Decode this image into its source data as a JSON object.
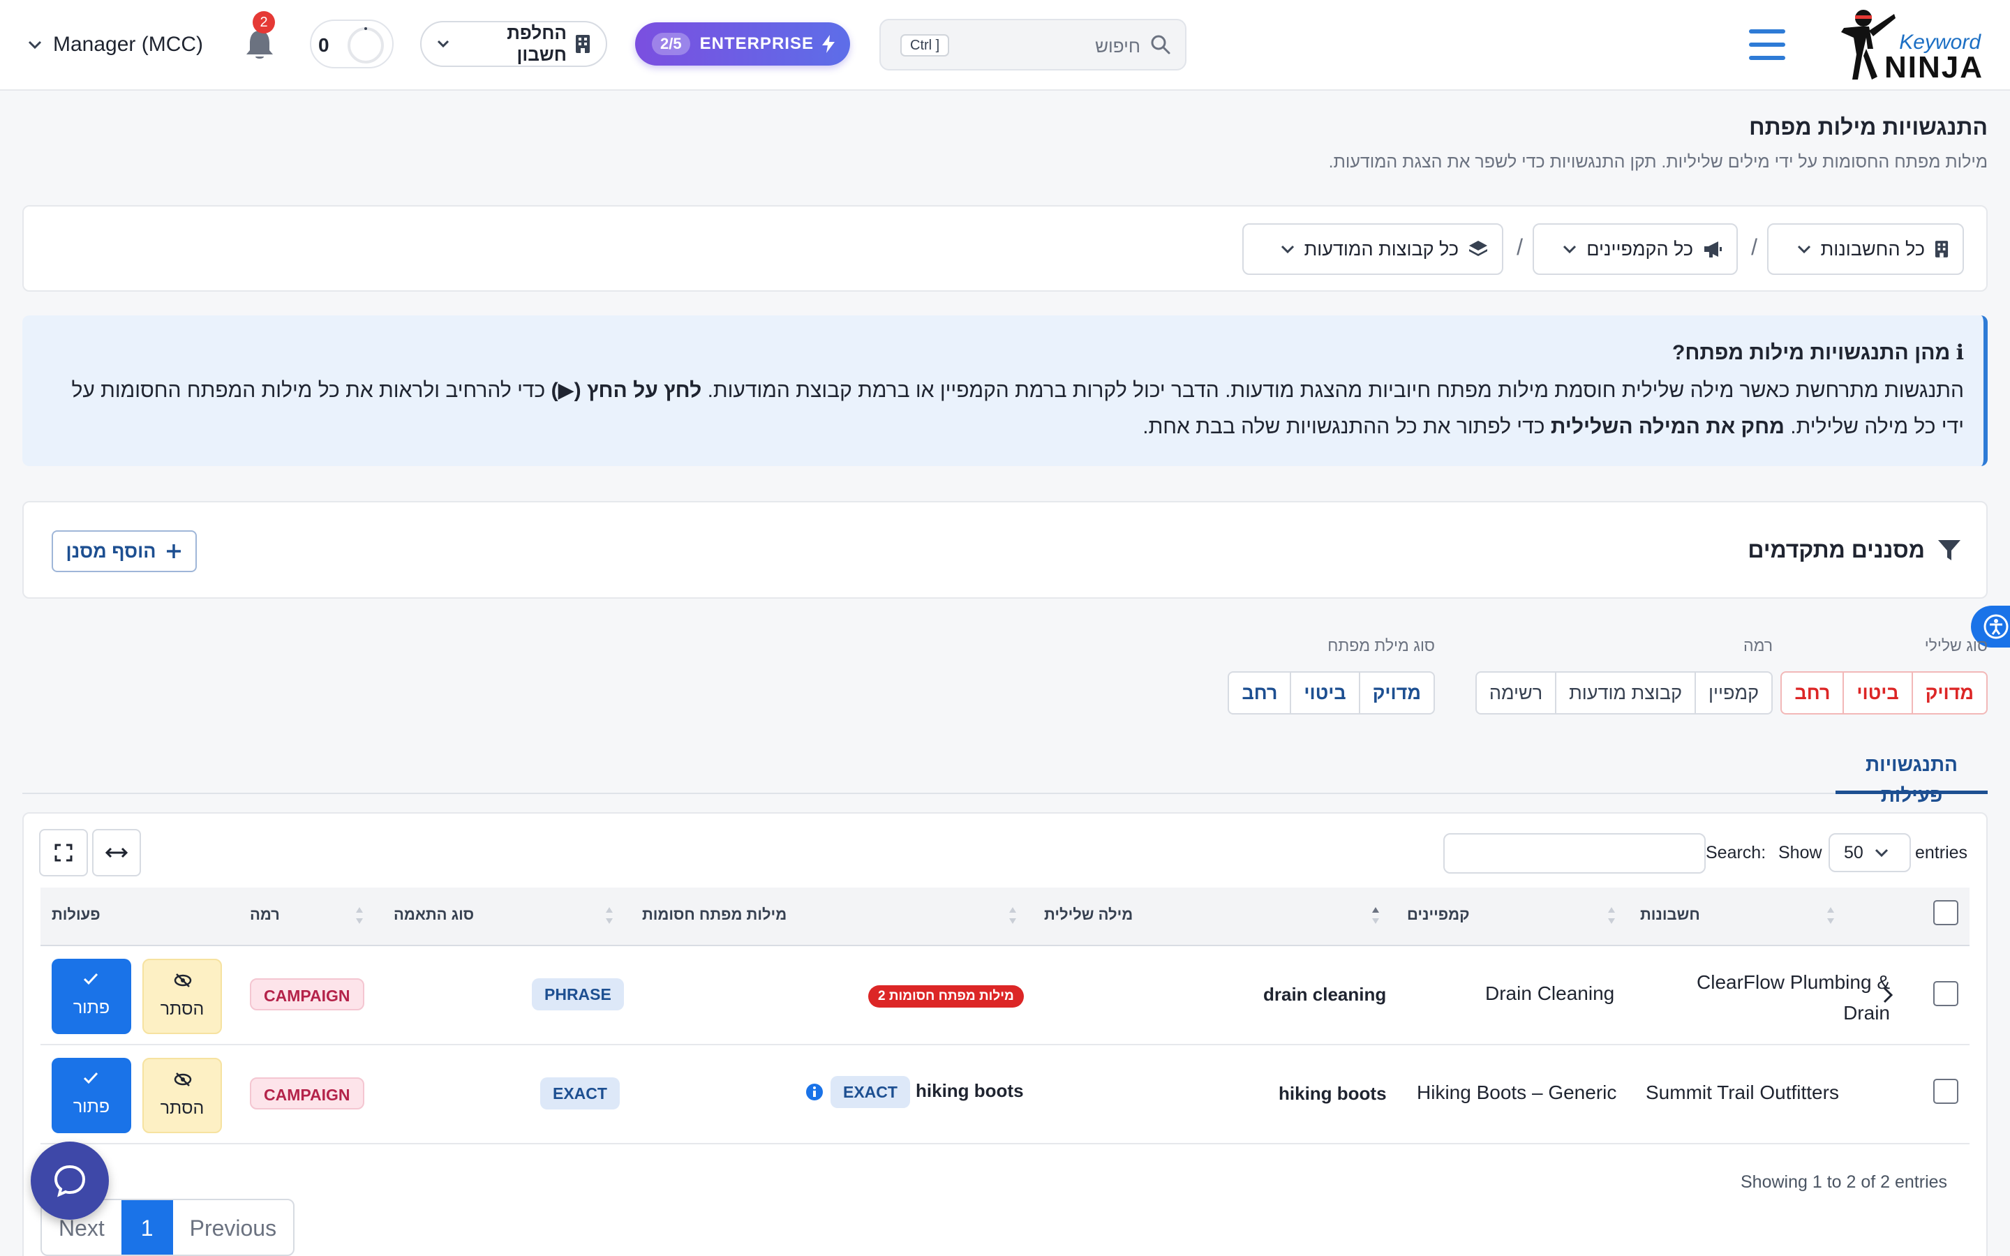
{
  "nav": {
    "logo_keyword": "Keyword",
    "logo_ninja": "NINJA",
    "search_placeholder": "חיפוש",
    "search_shortcut": "Ctrl ]",
    "plan_count": "2/5",
    "plan_label": "ENTERPRISE",
    "switch_account": "החלפת חשבון",
    "counter_value": "0",
    "notifications_count": "2",
    "account_name": "Manager (MCC)"
  },
  "page": {
    "title": "התנגשויות מילות מפתח",
    "subtitle": "מילות מפתח החסומות על ידי מילים שליליות. תקן התנגשויות כדי לשפר את הצגת המודעות."
  },
  "selectors": {
    "accounts": "כל החשבונות",
    "campaigns": "כל הקמפיינים",
    "ad_groups": "כל קבוצות המודעות",
    "separator": "/"
  },
  "info": {
    "heading": "ℹ מהן התנגשויות מילות מפתח?",
    "text_1": "התנגשות מתרחשת כאשר מילה שלילית חוסמת מילות מפתח חיוביות מהצגת מודעות. הדבר יכול לקרות ברמת הקמפיין או ברמת קבוצת המודעות.",
    "bold_1": "לחץ על החץ (▶)",
    "text_2": "כדי להרחיב ולראות את כל מילות המפתח החסומות על ידי כל מילה שלילית.",
    "bold_2": "מחק את המילה השלילית",
    "text_3": "כדי לפתור את כל ההתנגשויות שלה בבת אחת."
  },
  "advanced": {
    "title": "מסננים מתקדמים",
    "add_filter": "הוסף מסנן"
  },
  "filters": {
    "negative_type": {
      "label": "סוג שלילי",
      "options": [
        "מדויק",
        "ביטוי",
        "רחב"
      ]
    },
    "level": {
      "label": "רמה",
      "options": [
        "קמפיין",
        "קבוצת מודעות",
        " רשימה"
      ]
    },
    "keyword_type": {
      "label": "סוג מילת מפתח",
      "options": [
        "מדויק",
        "ביטוי",
        "רחב"
      ]
    }
  },
  "tab": {
    "active": "התנגשויות פעילות"
  },
  "table": {
    "show_label": "Show",
    "entries_value": "50",
    "entries_label": "entries",
    "search_label": "Search:",
    "columns": {
      "accounts": "חשבונות",
      "campaigns": "קמפיינים",
      "negative": "מילה שלילית",
      "blocked": "מילות מפתח חסומות",
      "match": "סוג התאמה",
      "level": "רמה",
      "actions": "פעולות"
    },
    "rows": [
      {
        "account_line1": "ClearFlow Plumbing &",
        "account_line2": "Drain",
        "campaign": "Drain Cleaning",
        "negative": "drain cleaning",
        "blocked_badge": "2 מילות מפתח חסומות",
        "match": "PHRASE",
        "level": " CAMPAIGN",
        "hide": "הסתר",
        "fix": "פתור"
      },
      {
        "account": "Summit Trail Outfitters",
        "campaign": "Hiking Boots – Generic",
        "negative": "hiking boots",
        "blocked_keyword": "hiking boots",
        "blocked_match": "EXACT",
        "match": "EXACT",
        "level": " CAMPAIGN",
        "hide": "הסתר",
        "fix": "פתור"
      }
    ],
    "showing": "Showing 1 to 2 of 2 entries"
  },
  "pagination": {
    "previous": "Previous",
    "current": "1",
    "next": "Next"
  },
  "colors": {
    "primary": "#1a73e8",
    "brand_dark": "#1d4f91",
    "danger": "#dc2626",
    "enterprise_from": "#7b4fe0",
    "enterprise_to": "#5d6ee8"
  }
}
